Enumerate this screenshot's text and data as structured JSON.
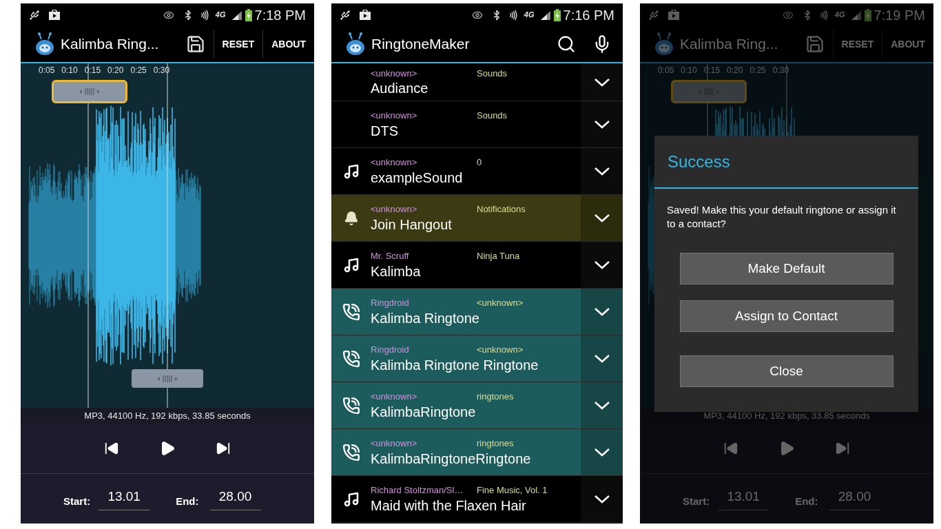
{
  "phones": [
    {
      "kind": "editor",
      "dimmed": false,
      "status": {
        "network": "4G",
        "time": "7:18 PM"
      },
      "title": "Kalimba Ring...",
      "actions": [
        "RESET",
        "ABOUT"
      ],
      "ticks": [
        "0:05",
        "0:10",
        "0:15",
        "0:20",
        "0:25",
        "0:30"
      ],
      "info": "MP3, 44100 Hz, 192 kbps, 33.85 seconds",
      "start_label": "Start:",
      "start_value": "13.01",
      "end_label": "End:",
      "end_value": "28.00"
    },
    {
      "kind": "list",
      "status": {
        "network": "4G",
        "time": "7:16 PM"
      },
      "title": "RingtoneMaker",
      "rows": [
        {
          "kind": "plain",
          "artist": "<unknown>",
          "album": "Sounds",
          "name": "Audiance"
        },
        {
          "kind": "plain",
          "artist": "<unknown>",
          "album": "Sounds",
          "name": "DTS"
        },
        {
          "kind": "music",
          "artist": "<unknown>",
          "album": "0",
          "name": "exampleSound"
        },
        {
          "kind": "notification",
          "artist": "<unknown>",
          "album": "Notifications",
          "name": "Join Hangout"
        },
        {
          "kind": "music",
          "artist": "Mr. Scruff",
          "album": "Ninja Tuna",
          "name": "Kalimba"
        },
        {
          "kind": "ringtone",
          "artist": "Ringdroid",
          "album": "<unknown>",
          "name": "Kalimba Ringtone"
        },
        {
          "kind": "ringtone",
          "artist": "Ringdroid",
          "album": "<unknown>",
          "name": "Kalimba Ringtone Ringtone"
        },
        {
          "kind": "ringtone",
          "artist": "<unknown>",
          "album": "ringtones",
          "name": "KalimbaRingtone"
        },
        {
          "kind": "ringtone",
          "artist": "<unknown>",
          "album": "ringtones",
          "name": "KalimbaRingtoneRingtone"
        },
        {
          "kind": "music",
          "artist": "Richard Stoltzman/Sl…",
          "album": "Fine Music, Vol. 1",
          "name": "Maid with the Flaxen Hair"
        }
      ]
    },
    {
      "kind": "editor",
      "dimmed": true,
      "status": {
        "network": "4G",
        "time": "7:19 PM"
      },
      "title": "Kalimba Ring...",
      "actions": [
        "RESET",
        "ABOUT"
      ],
      "ticks": [
        "0:05",
        "0:10",
        "0:15",
        "0:20",
        "0:25",
        "0:30"
      ],
      "info": "MP3, 44100 Hz, 192 kbps, 33.85 seconds",
      "start_label": "Start:",
      "start_value": "13.01",
      "end_label": "End:",
      "end_value": "28.00",
      "dialog": {
        "title": "Success",
        "message": "Saved! Make this your default ringtone or assign it to a contact?",
        "buttons": [
          "Make Default",
          "Assign to Contact",
          "Close"
        ]
      }
    }
  ]
}
